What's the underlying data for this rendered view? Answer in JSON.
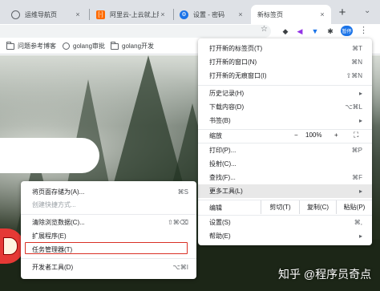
{
  "tabs": [
    {
      "title": "运维导航页",
      "icon": "globe-icon",
      "close": "×"
    },
    {
      "title": "阿里云-上云就上阿",
      "icon": "aliyun-logo-icon",
      "close": "×"
    },
    {
      "title": "设置 - 密码",
      "icon": "settings-icon",
      "close": "×"
    },
    {
      "title": "新标签页",
      "close": "×"
    }
  ],
  "toolbar": {
    "new_tab": "+",
    "profile_label": "暂停",
    "star": "☆",
    "menu": "⋮",
    "tab_strip_chevron": "⌄"
  },
  "bookmarks": [
    {
      "label": "问题参考博客",
      "icon": "folder-icon"
    },
    {
      "label": "golang审批",
      "icon": "globe-icon"
    },
    {
      "label": "golang开发",
      "icon": "folder-icon"
    }
  ],
  "main_menu": {
    "items": [
      {
        "label": "打开新的标签页(T)",
        "shortcut": "⌘T"
      },
      {
        "label": "打开新的窗口(N)",
        "shortcut": "⌘N"
      },
      {
        "label": "打开新的无痕窗口(I)",
        "shortcut": "⇧⌘N"
      },
      {
        "label": "历史记录(H)",
        "shortcut": "▸"
      },
      {
        "label": "下载内容(D)",
        "shortcut": "⌥⌘L"
      },
      {
        "label": "书签(B)",
        "shortcut": "▸"
      },
      {
        "label": "打印(P)...",
        "shortcut": "⌘P"
      },
      {
        "label": "投射(C)...",
        "shortcut": ""
      },
      {
        "label": "查找(F)...",
        "shortcut": "⌘F"
      },
      {
        "label": "更多工具(L)",
        "shortcut": "▸"
      },
      {
        "label": "设置(S)",
        "shortcut": "⌘,"
      },
      {
        "label": "帮助(E)",
        "shortcut": "▸"
      }
    ],
    "zoom": {
      "label": "缩放",
      "minus": "−",
      "value": "100%",
      "plus": "+",
      "fullscreen": "⛶"
    },
    "edit": {
      "label": "编辑",
      "cut": "剪切(T)",
      "copy": "复制(C)",
      "paste": "粘贴(P)"
    }
  },
  "more_tools_menu": {
    "items": [
      {
        "label": "将页面存储为(A)...",
        "shortcut": "⌘S",
        "enabled": true
      },
      {
        "label": "创建快捷方式...",
        "shortcut": "",
        "enabled": false
      },
      {
        "label": "清除浏览数据(C)...",
        "shortcut": "⇧⌘⌫",
        "enabled": true
      },
      {
        "label": "扩展程序(E)",
        "shortcut": "",
        "enabled": true
      },
      {
        "label": "任务管理器(T)",
        "shortcut": "",
        "enabled": true
      },
      {
        "label": "开发者工具(D)",
        "shortcut": "⌥⌘I",
        "enabled": true
      }
    ]
  },
  "watermark": "知乎 @程序员奇点",
  "colors": {
    "highlight_box": "#d93025",
    "menu_hover": "#e8e8e8",
    "profile": "#1a73e8"
  }
}
